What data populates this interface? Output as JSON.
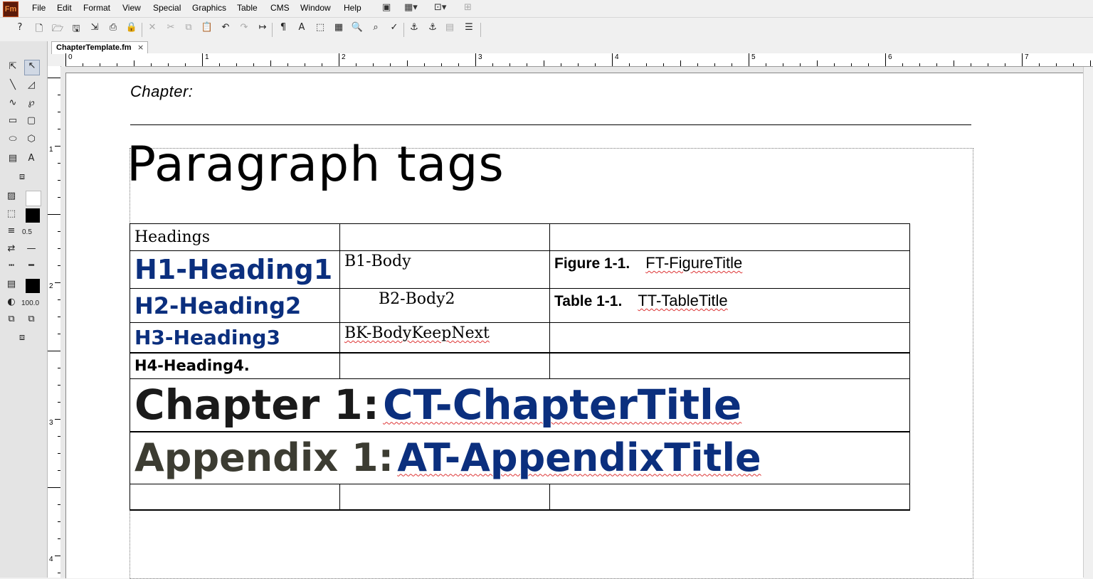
{
  "app": {
    "logo_text": "Fm"
  },
  "menu": [
    "File",
    "Edit",
    "Format",
    "View",
    "Special",
    "Graphics",
    "Table",
    "CMS",
    "Window",
    "Help"
  ],
  "document_tab": {
    "label": "ChapterTemplate.fm",
    "close_glyph": "×"
  },
  "palette": {
    "line_width": "0.5",
    "tint": "100.0"
  },
  "ruler": {
    "top_numbers": [
      "0",
      "1",
      "2",
      "3",
      "4",
      "5",
      "6",
      "7"
    ],
    "left_numbers": [
      "1",
      "2",
      "3",
      "4"
    ]
  },
  "page": {
    "running_header": "Chapter:",
    "title": "Paragraph tags"
  },
  "table": {
    "rows": [
      {
        "c1": "Headings",
        "c2": "",
        "c3_label": "",
        "c3_text": ""
      },
      {
        "c1": "H1-Heading1",
        "c2": "B1-Body",
        "c3_label": "Figure 1-1.",
        "c3_text": "FT-FigureTitle"
      },
      {
        "c1": "H2-Heading2",
        "c2": "B2-Body2",
        "c3_label": "Table 1-1.",
        "c3_text": "TT-TableTitle"
      },
      {
        "c1": "H3-Heading3",
        "c2": "BK-BodyKeepNext",
        "c3_label": "",
        "c3_text": ""
      },
      {
        "c1": "H4-Heading4.",
        "c2": "",
        "c3_label": "",
        "c3_text": ""
      }
    ],
    "chapter_row": {
      "prefix": "Chapter 1:",
      "title": "CT-ChapterTitle"
    },
    "appendix_row": {
      "prefix": "Appendix 1:",
      "title": "AT-AppendixTitle"
    }
  }
}
